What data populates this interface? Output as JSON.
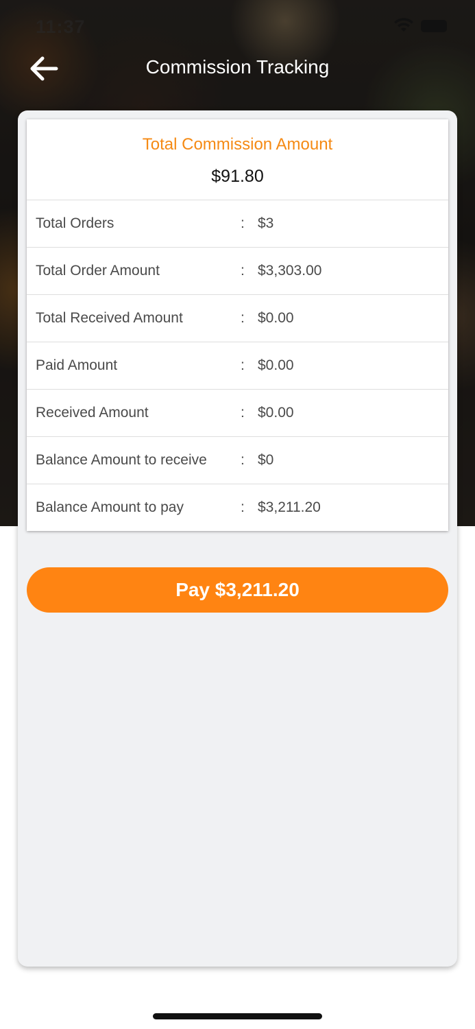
{
  "status_bar": {
    "time": "11:37"
  },
  "header": {
    "title": "Commission Tracking"
  },
  "summary": {
    "title": "Total Commission Amount",
    "value": "$91.80",
    "separator": ":",
    "rows": [
      {
        "label": "Total Orders",
        "value": "$3"
      },
      {
        "label": "Total Order Amount",
        "value": "$3,303.00"
      },
      {
        "label": "Total Received Amount",
        "value": "$0.00"
      },
      {
        "label": "Paid Amount",
        "value": "$0.00"
      },
      {
        "label": "Received Amount",
        "value": "$0.00"
      },
      {
        "label": "Balance Amount to receive",
        "value": "$0"
      },
      {
        "label": "Balance Amount to pay",
        "value": "$3,211.20"
      }
    ]
  },
  "pay_button": {
    "label": "Pay $3,211.20"
  },
  "colors": {
    "accent": "#ff8412",
    "title_orange": "#f58a14",
    "card_bg": "#f0f1f3"
  },
  "icons": {
    "back": "arrow-left-icon",
    "wifi": "wifi-icon",
    "battery": "battery-icon"
  }
}
